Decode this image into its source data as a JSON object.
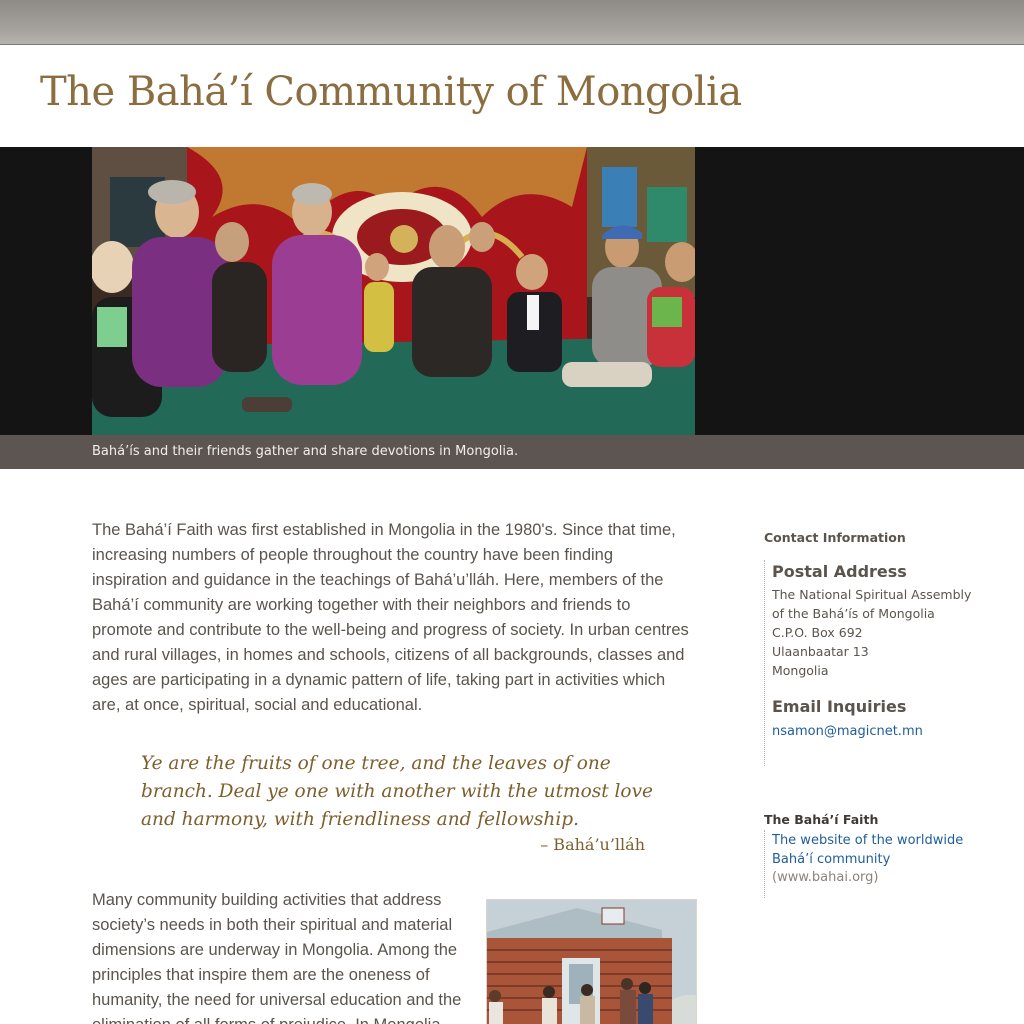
{
  "site": {
    "title": "The Bahá’í Community of Mongolia"
  },
  "hero": {
    "caption": "Bahá’ís and their friends gather and share devotions in Mongolia."
  },
  "main": {
    "intro": "The Bahá’í Faith was first established in Mongolia in the 1980's. Since that time, increasing numbers of people throughout the country have been finding inspiration and guidance in the teachings of Bahá’u’lláh. Here, members of the Bahá’í community are working together with their neighbors and friends to promote and contribute to the well-being and progress of society. In urban centres and rural villages, in homes and schools, citizens of all backgrounds, classes and ages are participating in a dynamic pattern of life, taking part in activities which are, at once, spiritual, social and educational.",
    "quote": "Ye are the fruits of one tree, and the leaves of one branch. Deal ye one with another with the utmost love and harmony, with friendliness and fellowship.",
    "quote_attribution": "– Bahá’u’lláh",
    "paragraph2": "Many community building activities that address society’s needs in both their spiritual and material dimensions are underway in Mongolia. Among the principles that inspire them are the oneness of humanity, the need for universal education and the elimination of all forms of prejudice. In Mongolia,"
  },
  "sidebar": {
    "contact_heading": "Contact Information",
    "postal_label": "Postal Address",
    "address_lines": [
      "The National Spiritual Assembly",
      "of the Bahá’ís of Mongolia",
      "C.P.O. Box 692",
      "Ulaanbaatar 13",
      "Mongolia"
    ],
    "email_label": "Email Inquiries",
    "email": "nsamon@magicnet.mn",
    "faith_heading": "The Bahá’í Faith",
    "faith_link": "The website of the worldwide Bahá’í community",
    "faith_url": "(www.bahai.org)"
  },
  "colors": {
    "title": "#8b6d3f",
    "quote": "#7d5f2d",
    "link": "#1f5d9a",
    "caption_bar": "#5c5551",
    "hero_band": "#141414"
  }
}
